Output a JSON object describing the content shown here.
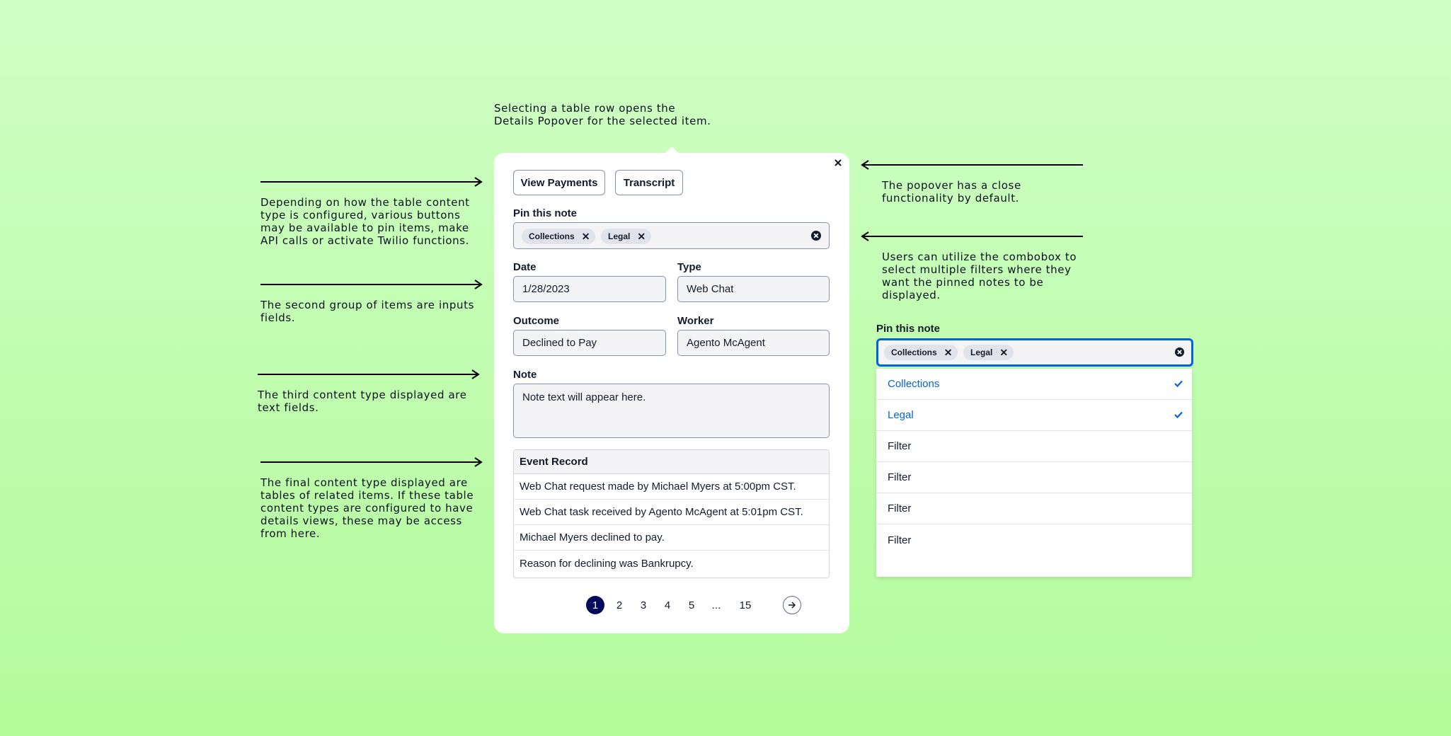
{
  "annotations": {
    "top": [
      "Selecting a table row opens the",
      "Details Popover for the selected item."
    ],
    "buttons": [
      "Depending on how the table content",
      "type is configured, various buttons",
      "may be available to pin items, make",
      "API calls or activate Twilio functions."
    ],
    "inputs": [
      "The second group of items are inputs",
      "fields."
    ],
    "textfields": [
      "The third content type displayed are",
      "text fields."
    ],
    "tables": [
      "The final content type displayed are",
      "tables of related items. If these table",
      "content types are configured to have",
      "details views, these may be access",
      "from here."
    ],
    "close": [
      "The popover has a close",
      "functionality by default."
    ],
    "combobox": [
      "Users can utilize the combobox to",
      "select multiple filters where they",
      "want the pinned notes to be",
      "displayed."
    ]
  },
  "popover": {
    "close_icon": "close-icon",
    "buttons": {
      "view_payments": "View Payments",
      "transcript": "Transcript"
    },
    "pin": {
      "label": "Pin this note",
      "chips": [
        "Collections",
        "Legal"
      ]
    },
    "date": {
      "label": "Date",
      "value": "1/28/2023"
    },
    "type": {
      "label": "Type",
      "value": "Web Chat"
    },
    "outcome": {
      "label": "Outcome",
      "value": "Declined to Pay"
    },
    "worker": {
      "label": "Worker",
      "value": "Agento McAgent"
    },
    "note": {
      "label": "Note",
      "value": "Note text will appear here."
    },
    "event_table": {
      "header": "Event Record",
      "rows": [
        "Web Chat request made by Michael Myers at 5:00pm CST.",
        "Web Chat task received by Agento McAgent at 5:01pm CST.",
        "Michael Myers declined to pay.",
        "Reason for declining was Bankrupcy."
      ]
    },
    "pagination": {
      "pages": [
        "1",
        "2",
        "3",
        "4",
        "5",
        "...",
        "15"
      ],
      "current": "1",
      "next_icon": "arrow-right-icon"
    }
  },
  "combobox_example": {
    "label": "Pin this note",
    "chips": [
      "Collections",
      "Legal"
    ],
    "options": [
      {
        "label": "Collections",
        "selected": true
      },
      {
        "label": "Legal",
        "selected": true
      },
      {
        "label": "Filter",
        "selected": false
      },
      {
        "label": "Filter",
        "selected": false
      },
      {
        "label": "Filter",
        "selected": false
      },
      {
        "label": "Filter",
        "selected": false
      }
    ]
  },
  "colors": {
    "accent": "#0263e0",
    "pagination_active": "#030b5d",
    "background": "#c2fdb2"
  }
}
